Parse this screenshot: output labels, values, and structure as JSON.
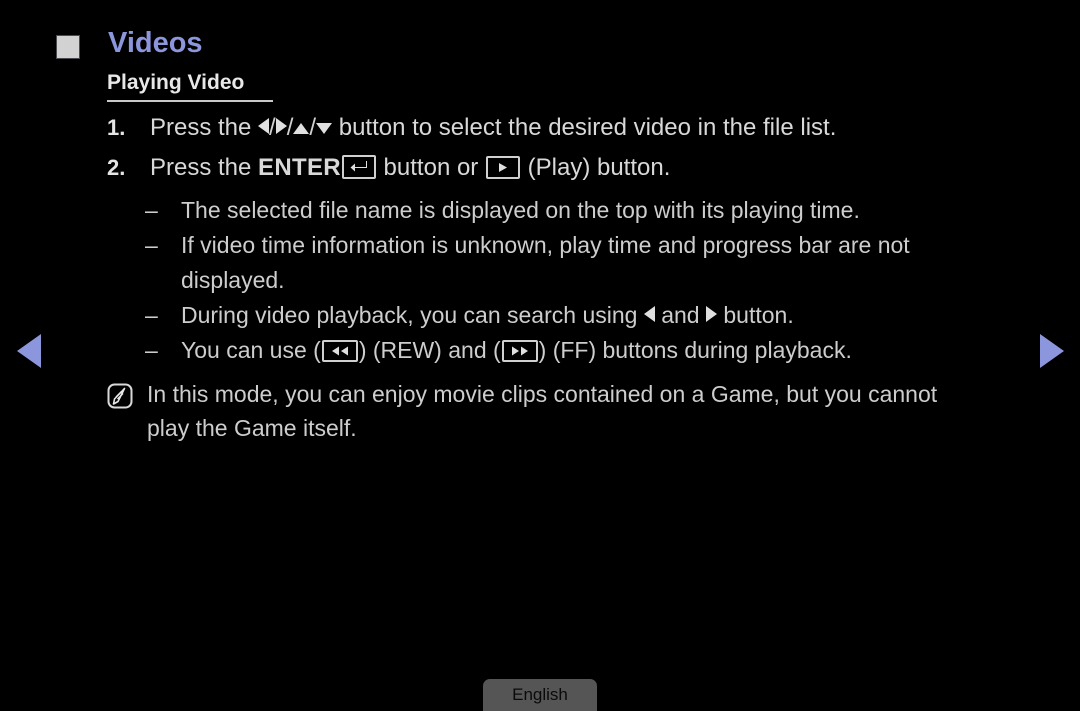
{
  "header": {
    "title": "Videos",
    "bullet_icon": "filled-square-icon",
    "title_color": "#8c96dc"
  },
  "subsection": {
    "title": "Playing Video"
  },
  "steps": [
    {
      "marker": "1.",
      "prefix": "Press the ",
      "icons": [
        "triangle-left-icon",
        "triangle-right-icon",
        "triangle-up-icon",
        "triangle-down-icon"
      ],
      "separator": "/",
      "suffix": " button to select the desired video in the file list."
    },
    {
      "marker": "2.",
      "prefix": "Press the ",
      "enter_label": "ENTER",
      "enter_icon": "enter-return-key-icon",
      "middle": " button or ",
      "play_icon": "play-button-icon",
      "suffix": " (Play) button."
    }
  ],
  "bullets": [
    {
      "marker": "–",
      "text": "The selected file name is displayed on the top with its playing time."
    },
    {
      "marker": "–",
      "text": "If video time information is unknown, play time and progress bar are not displayed."
    },
    {
      "marker": "–",
      "prefix": "During video playback, you can search using ",
      "left_icon": "triangle-left-icon",
      "middle": " and ",
      "right_icon": "triangle-right-icon",
      "suffix": " button."
    },
    {
      "marker": "–",
      "prefix": "You can use (",
      "rew_icon": "rewind-button-icon",
      "middle1": ") (REW) and (",
      "ff_icon": "fast-forward-button-icon",
      "suffix": ") (FF) buttons during playback."
    }
  ],
  "note": {
    "icon": "note-pen-icon",
    "text": "In this mode, you can enjoy movie clips contained on a Game, but you cannot play the Game itself."
  },
  "navigation": {
    "prev_icon": "nav-arrow-left-icon",
    "next_icon": "nav-arrow-right-icon",
    "arrow_color": "#8c96dc"
  },
  "footer": {
    "language": "English"
  }
}
